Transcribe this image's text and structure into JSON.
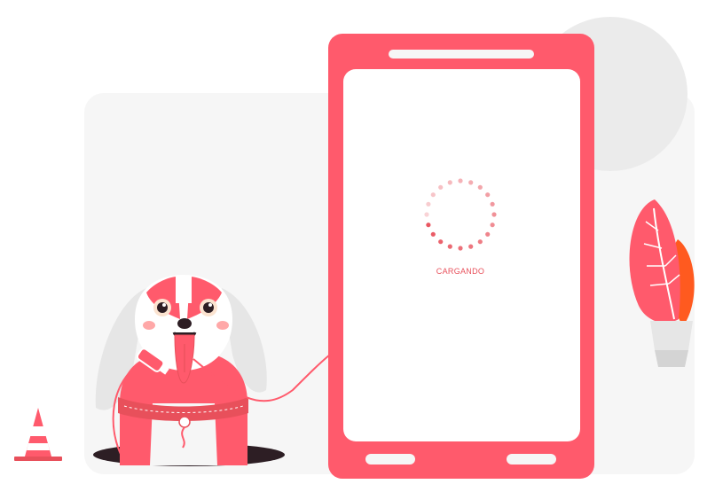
{
  "loader": {
    "label": "CARGANDO",
    "dot_count": 20
  },
  "colors": {
    "accent": "#ff5a6c",
    "accent_dark": "#e8505b",
    "orange": "#ff5a1f",
    "light_gray": "#f5f5f5",
    "mid_gray": "#e6e6e6",
    "dark": "#2d1e24"
  }
}
